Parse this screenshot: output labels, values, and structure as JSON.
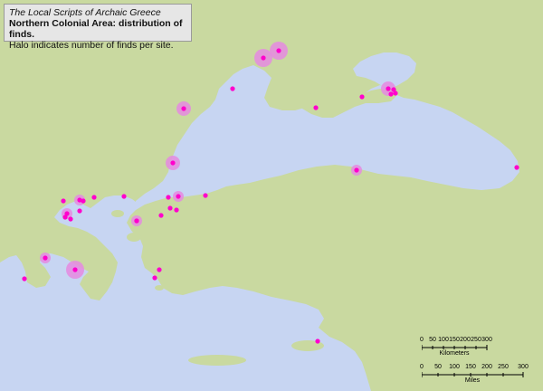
{
  "title_box": {
    "line1": "The Local Scripts of Archaic Greece",
    "line2": "Northern Colonial Area: distribution of finds.",
    "line3": "Halo indicates number of finds per site."
  },
  "colors": {
    "land": "#c9d9a0",
    "sea": "#c7d5f2",
    "site": "#ff00cc",
    "halo": "#e58ae1"
  },
  "scale_km": {
    "ticks": [
      "0",
      "50",
      "100",
      "150",
      "200",
      "250",
      "300"
    ],
    "unit": "Kilometers"
  },
  "scale_mi": {
    "ticks": [
      "0",
      "50",
      "100",
      "150",
      "200",
      "250",
      "300"
    ],
    "unit": "Miles"
  },
  "sites": [
    {
      "id": "olbia",
      "halo": 3
    },
    {
      "id": "berezan",
      "halo": 3
    },
    {
      "id": "tyras",
      "halo": 0
    },
    {
      "id": "nikonion",
      "halo": 2
    },
    {
      "id": "istros",
      "halo": 2
    },
    {
      "id": "kerkinitis",
      "halo": 0
    },
    {
      "id": "theodosia",
      "halo": 0
    },
    {
      "id": "pantikapaion",
      "halo": 2
    },
    {
      "id": "myrmekion",
      "halo": 0
    },
    {
      "id": "hermonassa",
      "halo": 0
    },
    {
      "id": "phanagoria",
      "halo": 0
    },
    {
      "id": "sinope",
      "halo": 1
    },
    {
      "id": "phasis",
      "halo": 0
    },
    {
      "id": "apollonia",
      "halo": 0
    },
    {
      "id": "byzantion",
      "halo": 1
    },
    {
      "id": "perinthos",
      "halo": 0
    },
    {
      "id": "selymbria",
      "halo": 0
    },
    {
      "id": "abdera",
      "halo": 0
    },
    {
      "id": "maroneia",
      "halo": 0
    },
    {
      "id": "thasos",
      "halo": 0
    },
    {
      "id": "amphipolis",
      "halo": 0
    },
    {
      "id": "akanthos",
      "halo": 1
    },
    {
      "id": "torone",
      "halo": 0
    },
    {
      "id": "mende",
      "halo": 0
    },
    {
      "id": "methone",
      "halo": 1
    },
    {
      "id": "pydna",
      "halo": 0
    },
    {
      "id": "samothrace",
      "halo": 0
    },
    {
      "id": "imbros",
      "halo": 0
    },
    {
      "id": "lemnos",
      "halo": 0
    },
    {
      "id": "lampsakos",
      "halo": 1
    },
    {
      "id": "delphi",
      "halo": 1
    },
    {
      "id": "athens",
      "halo": 3
    },
    {
      "id": "corinth",
      "halo": 0
    },
    {
      "id": "sounion",
      "halo": 0
    },
    {
      "id": "naxos",
      "halo": 0
    },
    {
      "id": "kyzikos",
      "halo": 0
    },
    {
      "id": "cyprus",
      "halo": 0
    }
  ]
}
